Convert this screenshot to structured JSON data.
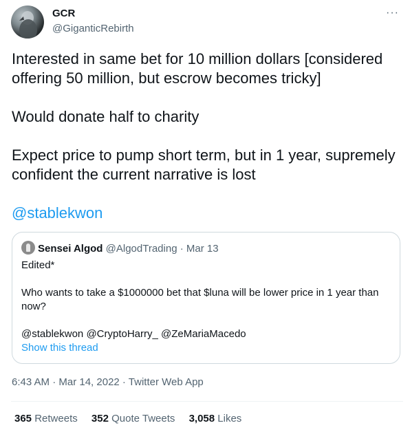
{
  "author": {
    "name": "GCR",
    "handle": "@GiganticRebirth"
  },
  "more_label": "···",
  "tweet": {
    "paragraph1": "Interested in same bet for 10 million dollars [considered offering 50 million, but escrow becomes tricky]",
    "paragraph2": "Would donate half to charity",
    "paragraph3": "Expect price to pump short term, but in 1 year, supremely confident the current narrative is lost",
    "mention": "@stablekwon"
  },
  "quoted": {
    "name": "Sensei Algod",
    "handle": "@AlgodTrading",
    "separator": " · ",
    "date": "Mar 13",
    "edited": "Edited*",
    "question": "Who wants to take a $1000000 bet that $luna will be lower price in 1 year than now?",
    "mentions": "@stablekwon @CryptoHarry_ @ZeMariaMacedo",
    "show_thread": "Show this thread"
  },
  "timestamp": "6:43 AM · Mar 14, 2022 · Twitter Web App",
  "stats": {
    "retweets_count": "365",
    "retweets_label": "Retweets",
    "quotes_count": "352",
    "quotes_label": "Quote Tweets",
    "likes_count": "3,058",
    "likes_label": "Likes"
  }
}
